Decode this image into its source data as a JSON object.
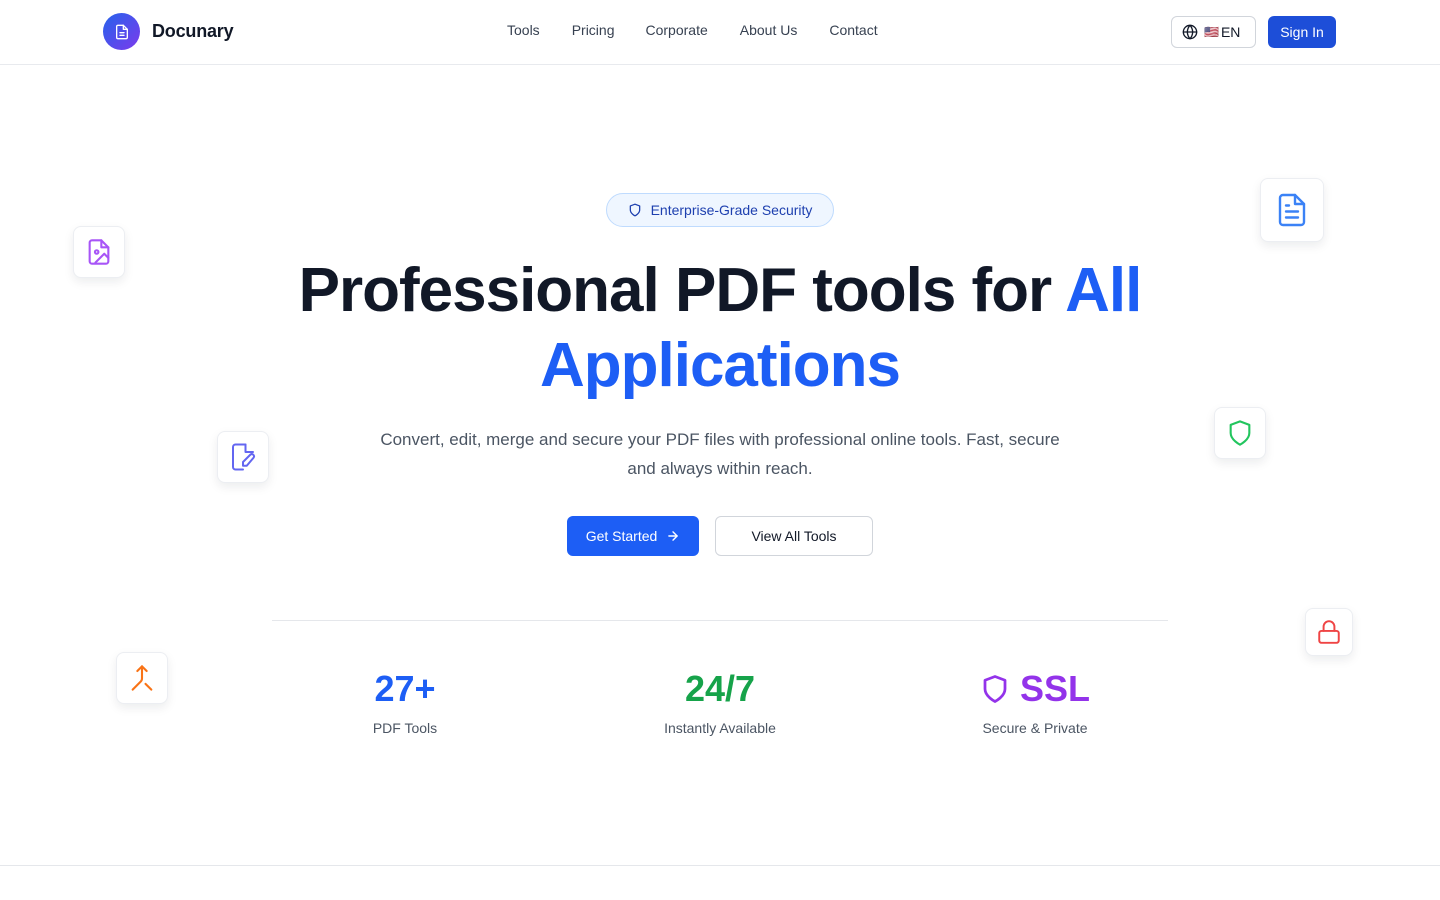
{
  "header": {
    "brand": "Docunary",
    "nav": [
      "Tools",
      "Pricing",
      "Corporate",
      "About Us",
      "Contact"
    ],
    "language_flag": "🇺🇸",
    "language_label": "EN",
    "signin_label": "Sign In"
  },
  "hero": {
    "badge": "Enterprise-Grade Security",
    "headline_part1": "Professional PDF tools for",
    "headline_accent1": "All",
    "headline_accent2": "Applications",
    "subtitle": "Convert, edit, merge and secure your PDF files with professional online tools. Fast, secure and always within reach.",
    "primary_cta": "Get Started",
    "secondary_cta": "View All Tools"
  },
  "stats": [
    {
      "value": "27+",
      "label": "PDF Tools"
    },
    {
      "value": "24/7",
      "label": "Instantly Available"
    },
    {
      "value": "SSL",
      "label": "Secure & Private"
    }
  ],
  "floating_icons": [
    "image-file-icon",
    "edit-file-icon",
    "merge-icon",
    "document-icon",
    "shield-icon",
    "lock-icon"
  ],
  "colors": {
    "accent": "#1d5ef5",
    "signin": "#1d4ed8",
    "stat_tools": "#1d5ef5",
    "stat_available": "#16a34a",
    "stat_ssl": "#9333ea",
    "badge_text": "#1e40af"
  }
}
